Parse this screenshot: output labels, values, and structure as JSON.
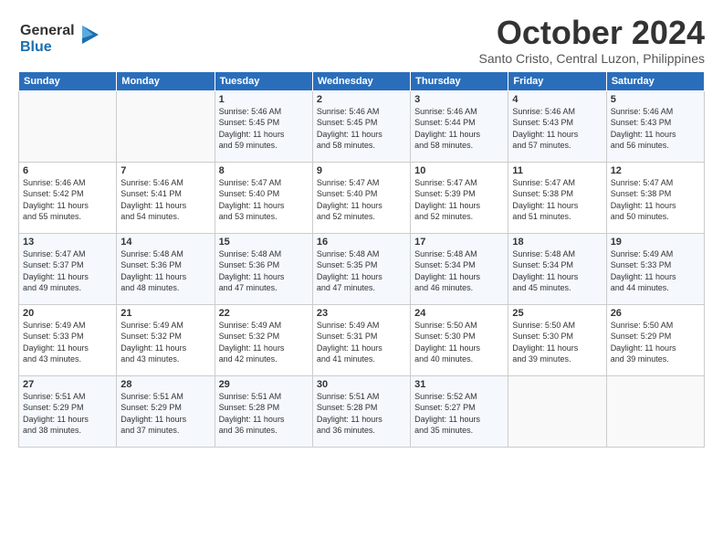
{
  "logo": {
    "line1": "General",
    "line2": "Blue",
    "arrow_color": "#1a6faf"
  },
  "header": {
    "month_year": "October 2024",
    "location": "Santo Cristo, Central Luzon, Philippines"
  },
  "days_of_week": [
    "Sunday",
    "Monday",
    "Tuesday",
    "Wednesday",
    "Thursday",
    "Friday",
    "Saturday"
  ],
  "weeks": [
    [
      {
        "day": "",
        "info": ""
      },
      {
        "day": "",
        "info": ""
      },
      {
        "day": "1",
        "info": "Sunrise: 5:46 AM\nSunset: 5:45 PM\nDaylight: 11 hours\nand 59 minutes."
      },
      {
        "day": "2",
        "info": "Sunrise: 5:46 AM\nSunset: 5:45 PM\nDaylight: 11 hours\nand 58 minutes."
      },
      {
        "day": "3",
        "info": "Sunrise: 5:46 AM\nSunset: 5:44 PM\nDaylight: 11 hours\nand 58 minutes."
      },
      {
        "day": "4",
        "info": "Sunrise: 5:46 AM\nSunset: 5:43 PM\nDaylight: 11 hours\nand 57 minutes."
      },
      {
        "day": "5",
        "info": "Sunrise: 5:46 AM\nSunset: 5:43 PM\nDaylight: 11 hours\nand 56 minutes."
      }
    ],
    [
      {
        "day": "6",
        "info": "Sunrise: 5:46 AM\nSunset: 5:42 PM\nDaylight: 11 hours\nand 55 minutes."
      },
      {
        "day": "7",
        "info": "Sunrise: 5:46 AM\nSunset: 5:41 PM\nDaylight: 11 hours\nand 54 minutes."
      },
      {
        "day": "8",
        "info": "Sunrise: 5:47 AM\nSunset: 5:40 PM\nDaylight: 11 hours\nand 53 minutes."
      },
      {
        "day": "9",
        "info": "Sunrise: 5:47 AM\nSunset: 5:40 PM\nDaylight: 11 hours\nand 52 minutes."
      },
      {
        "day": "10",
        "info": "Sunrise: 5:47 AM\nSunset: 5:39 PM\nDaylight: 11 hours\nand 52 minutes."
      },
      {
        "day": "11",
        "info": "Sunrise: 5:47 AM\nSunset: 5:38 PM\nDaylight: 11 hours\nand 51 minutes."
      },
      {
        "day": "12",
        "info": "Sunrise: 5:47 AM\nSunset: 5:38 PM\nDaylight: 11 hours\nand 50 minutes."
      }
    ],
    [
      {
        "day": "13",
        "info": "Sunrise: 5:47 AM\nSunset: 5:37 PM\nDaylight: 11 hours\nand 49 minutes."
      },
      {
        "day": "14",
        "info": "Sunrise: 5:48 AM\nSunset: 5:36 PM\nDaylight: 11 hours\nand 48 minutes."
      },
      {
        "day": "15",
        "info": "Sunrise: 5:48 AM\nSunset: 5:36 PM\nDaylight: 11 hours\nand 47 minutes."
      },
      {
        "day": "16",
        "info": "Sunrise: 5:48 AM\nSunset: 5:35 PM\nDaylight: 11 hours\nand 47 minutes."
      },
      {
        "day": "17",
        "info": "Sunrise: 5:48 AM\nSunset: 5:34 PM\nDaylight: 11 hours\nand 46 minutes."
      },
      {
        "day": "18",
        "info": "Sunrise: 5:48 AM\nSunset: 5:34 PM\nDaylight: 11 hours\nand 45 minutes."
      },
      {
        "day": "19",
        "info": "Sunrise: 5:49 AM\nSunset: 5:33 PM\nDaylight: 11 hours\nand 44 minutes."
      }
    ],
    [
      {
        "day": "20",
        "info": "Sunrise: 5:49 AM\nSunset: 5:33 PM\nDaylight: 11 hours\nand 43 minutes."
      },
      {
        "day": "21",
        "info": "Sunrise: 5:49 AM\nSunset: 5:32 PM\nDaylight: 11 hours\nand 43 minutes."
      },
      {
        "day": "22",
        "info": "Sunrise: 5:49 AM\nSunset: 5:32 PM\nDaylight: 11 hours\nand 42 minutes."
      },
      {
        "day": "23",
        "info": "Sunrise: 5:49 AM\nSunset: 5:31 PM\nDaylight: 11 hours\nand 41 minutes."
      },
      {
        "day": "24",
        "info": "Sunrise: 5:50 AM\nSunset: 5:30 PM\nDaylight: 11 hours\nand 40 minutes."
      },
      {
        "day": "25",
        "info": "Sunrise: 5:50 AM\nSunset: 5:30 PM\nDaylight: 11 hours\nand 39 minutes."
      },
      {
        "day": "26",
        "info": "Sunrise: 5:50 AM\nSunset: 5:29 PM\nDaylight: 11 hours\nand 39 minutes."
      }
    ],
    [
      {
        "day": "27",
        "info": "Sunrise: 5:51 AM\nSunset: 5:29 PM\nDaylight: 11 hours\nand 38 minutes."
      },
      {
        "day": "28",
        "info": "Sunrise: 5:51 AM\nSunset: 5:29 PM\nDaylight: 11 hours\nand 37 minutes."
      },
      {
        "day": "29",
        "info": "Sunrise: 5:51 AM\nSunset: 5:28 PM\nDaylight: 11 hours\nand 36 minutes."
      },
      {
        "day": "30",
        "info": "Sunrise: 5:51 AM\nSunset: 5:28 PM\nDaylight: 11 hours\nand 36 minutes."
      },
      {
        "day": "31",
        "info": "Sunrise: 5:52 AM\nSunset: 5:27 PM\nDaylight: 11 hours\nand 35 minutes."
      },
      {
        "day": "",
        "info": ""
      },
      {
        "day": "",
        "info": ""
      }
    ]
  ]
}
